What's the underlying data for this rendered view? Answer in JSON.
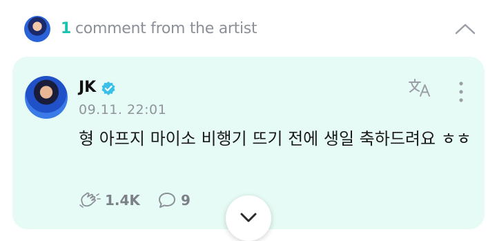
{
  "header": {
    "count": "1",
    "label": "comment from the artist",
    "collapse_icon": "chevron-up-icon"
  },
  "comment": {
    "author": "JK",
    "verified_icon": "verified-badge-icon",
    "timestamp": "09.11. 22:01",
    "text": "형 아프지 마이소 비행기 뜨기 전에 생일 축하드려요 ㅎㅎ",
    "translate_icon": "translate-icon",
    "more_icon": "more-vertical-icon",
    "likes": "1.4K",
    "like_icon": "like-hands-icon",
    "replies": "9",
    "reply_icon": "comment-bubble-icon"
  },
  "expand_icon": "chevron-down-icon",
  "colors": {
    "accent": "#19c2b0",
    "card_bg": "#e6fbf5",
    "verified": "#3ac0e8",
    "muted": "#8a8f98"
  }
}
